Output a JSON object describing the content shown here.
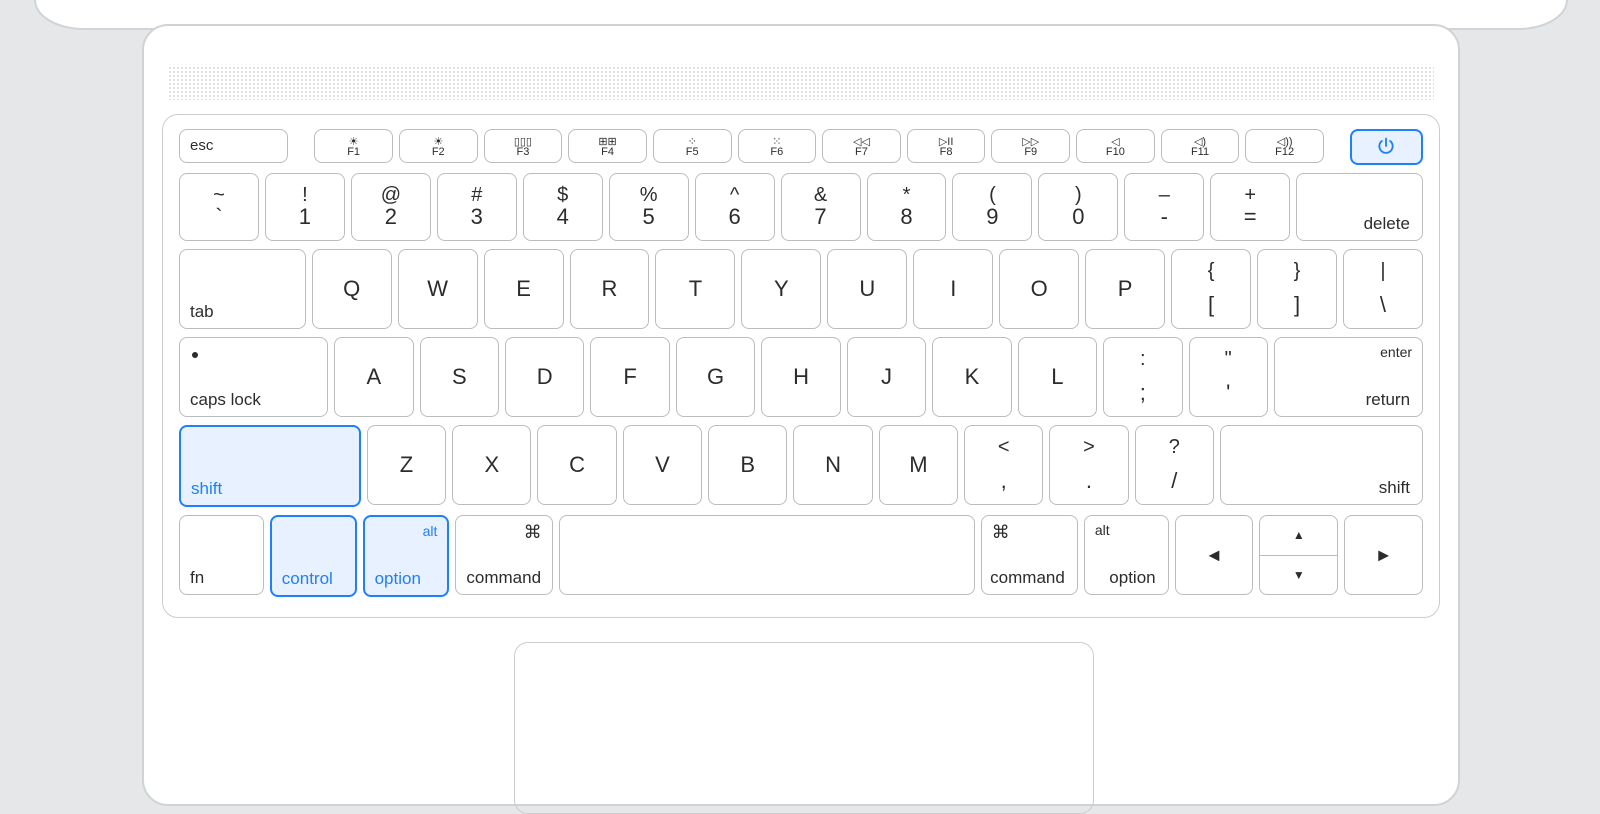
{
  "highlight_color": "#1e7fff",
  "function_row": {
    "esc": "esc",
    "keys": [
      {
        "glyph": "☀",
        "label": "F1"
      },
      {
        "glyph": "☀",
        "label": "F2"
      },
      {
        "glyph": "▯▯▯",
        "label": "F3"
      },
      {
        "glyph": "⊞⊞",
        "label": "F4"
      },
      {
        "glyph": "⁘",
        "label": "F5"
      },
      {
        "glyph": "⁙",
        "label": "F6"
      },
      {
        "glyph": "◁◁",
        "label": "F7"
      },
      {
        "glyph": "▷II",
        "label": "F8"
      },
      {
        "glyph": "▷▷",
        "label": "F9"
      },
      {
        "glyph": "◁",
        "label": "F10"
      },
      {
        "glyph": "◁)",
        "label": "F11"
      },
      {
        "glyph": "◁))",
        "label": "F12"
      }
    ],
    "power": "⏻"
  },
  "row1": {
    "keys": [
      {
        "top": "~",
        "main": "`"
      },
      {
        "top": "!",
        "main": "1"
      },
      {
        "top": "@",
        "main": "2"
      },
      {
        "top": "#",
        "main": "3"
      },
      {
        "top": "$",
        "main": "4"
      },
      {
        "top": "%",
        "main": "5"
      },
      {
        "top": "^",
        "main": "6"
      },
      {
        "top": "&",
        "main": "7"
      },
      {
        "top": "*",
        "main": "8"
      },
      {
        "top": "(",
        "main": "9"
      },
      {
        "top": ")",
        "main": "0"
      },
      {
        "top": "–",
        "main": "-"
      },
      {
        "top": "+",
        "main": "="
      }
    ],
    "delete": "delete"
  },
  "row2": {
    "tab": "tab",
    "letters": [
      "Q",
      "W",
      "E",
      "R",
      "T",
      "Y",
      "U",
      "I",
      "O",
      "P"
    ],
    "tail": [
      {
        "top": "{",
        "main": "["
      },
      {
        "top": "}",
        "main": "]"
      },
      {
        "top": "|",
        "main": "\\"
      }
    ]
  },
  "row3": {
    "caps": "caps lock",
    "letters": [
      "A",
      "S",
      "D",
      "F",
      "G",
      "H",
      "J",
      "K",
      "L"
    ],
    "tail": [
      {
        "top": ":",
        "main": ";"
      },
      {
        "top": "\"",
        "main": "'"
      }
    ],
    "return_top": "enter",
    "return": "return"
  },
  "row4": {
    "shiftL": "shift",
    "letters": [
      "Z",
      "X",
      "C",
      "V",
      "B",
      "N",
      "M"
    ],
    "tail": [
      {
        "top": "<",
        "main": ","
      },
      {
        "top": ">",
        "main": "."
      },
      {
        "top": "?",
        "main": "/"
      }
    ],
    "shiftR": "shift"
  },
  "row5": {
    "fn": "fn",
    "control": "control",
    "optionL_top": "alt",
    "optionL": "option",
    "cmdL_sym": "⌘",
    "cmdL": "command",
    "cmdR_sym": "⌘",
    "cmdR": "command",
    "optionR_top": "alt",
    "optionR": "option",
    "left": "◀",
    "up": "▲",
    "down": "▼",
    "right": "▶"
  }
}
